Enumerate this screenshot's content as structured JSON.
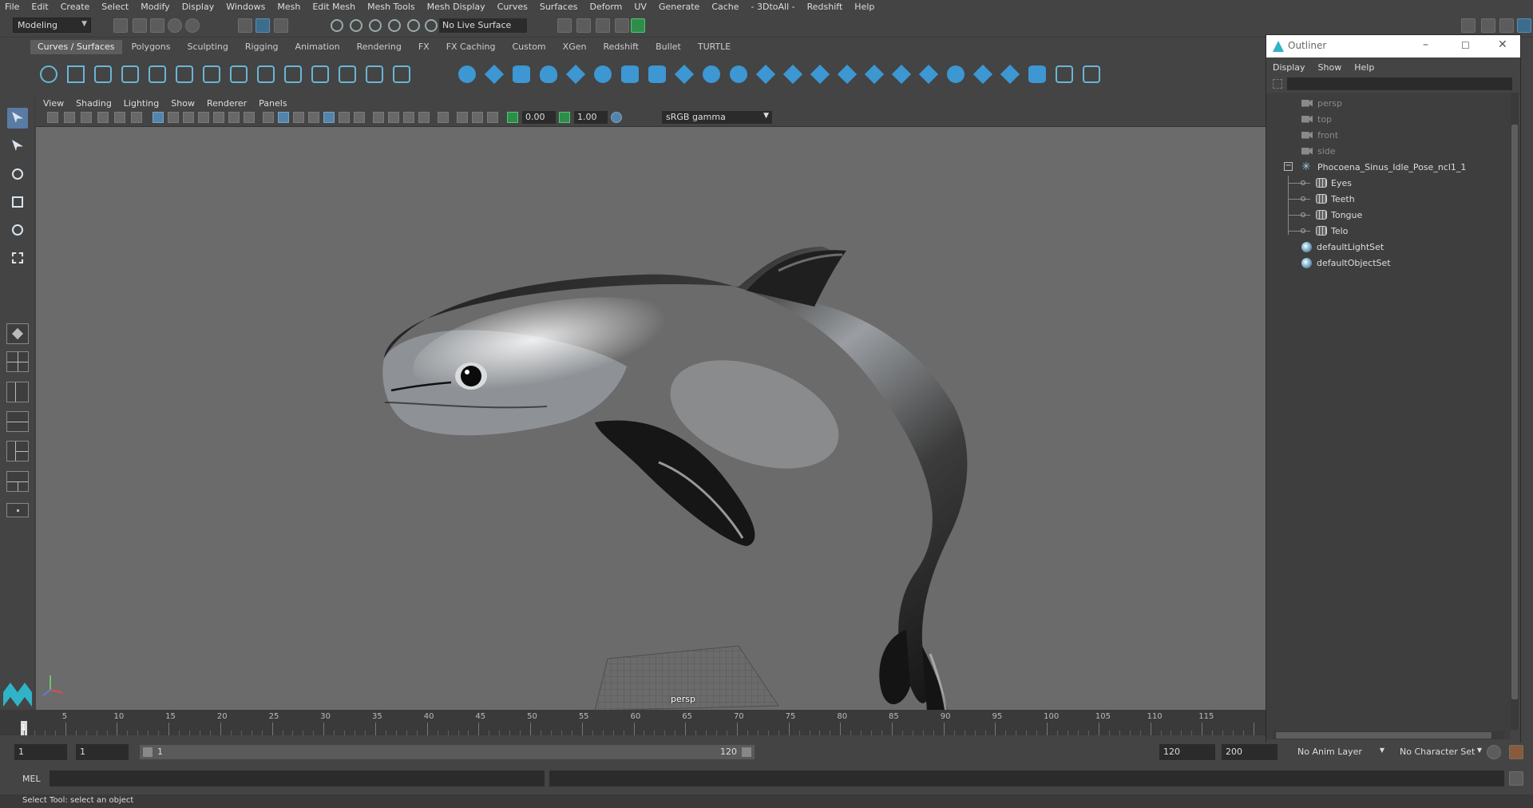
{
  "menubar": [
    "File",
    "Edit",
    "Create",
    "Select",
    "Modify",
    "Display",
    "Windows",
    "Mesh",
    "Edit Mesh",
    "Mesh Tools",
    "Mesh Display",
    "Curves",
    "Surfaces",
    "Deform",
    "UV",
    "Generate",
    "Cache",
    "- 3DtoAll -",
    "Redshift",
    "Help"
  ],
  "statusline": {
    "mode": "Modeling",
    "live_surface": "No Live Surface"
  },
  "shelf_tabs": [
    "Curves / Surfaces",
    "Polygons",
    "Sculpting",
    "Rigging",
    "Animation",
    "Rendering",
    "FX",
    "FX Caching",
    "Custom",
    "XGen",
    "Redshift",
    "Bullet",
    "TURTLE"
  ],
  "shelf_active": "Curves / Surfaces",
  "viewport": {
    "menu": [
      "View",
      "Shading",
      "Lighting",
      "Show",
      "Renderer",
      "Panels"
    ],
    "exposure": "0.00",
    "gamma": "1.00",
    "color_space": "sRGB gamma",
    "camera_label": "persp"
  },
  "outliner": {
    "title": "Outliner",
    "menu": [
      "Display",
      "Show",
      "Help"
    ],
    "items": [
      {
        "label": "persp",
        "type": "camera",
        "dim": true
      },
      {
        "label": "top",
        "type": "camera",
        "dim": true
      },
      {
        "label": "front",
        "type": "camera",
        "dim": true
      },
      {
        "label": "side",
        "type": "camera",
        "dim": true
      },
      {
        "label": "Phocoena_Sinus_Idle_Pose_ncl1_1",
        "type": "joint",
        "expanded": true
      },
      {
        "label": "Eyes",
        "type": "mesh",
        "child": true
      },
      {
        "label": "Teeth",
        "type": "mesh",
        "child": true
      },
      {
        "label": "Tongue",
        "type": "mesh",
        "child": true
      },
      {
        "label": "Telo",
        "type": "mesh",
        "child": true
      },
      {
        "label": "defaultLightSet",
        "type": "set"
      },
      {
        "label": "defaultObjectSet",
        "type": "set"
      }
    ]
  },
  "timeline": {
    "ticks": [
      "1",
      "5",
      "10",
      "15",
      "20",
      "25",
      "30",
      "35",
      "40",
      "45",
      "50",
      "55",
      "60",
      "65",
      "70",
      "75",
      "80",
      "85",
      "90",
      "95",
      "100",
      "105",
      "110",
      "115"
    ],
    "current_frame": "1"
  },
  "range": {
    "start": "1",
    "playback_start": "1",
    "slider_start": "1",
    "slider_end": "120",
    "playback_end": "120",
    "end": "200",
    "anim_layer": "No Anim Layer",
    "character_set": "No Character Set"
  },
  "command_line": {
    "label": "MEL"
  },
  "help_line": "Select Tool: select an object"
}
